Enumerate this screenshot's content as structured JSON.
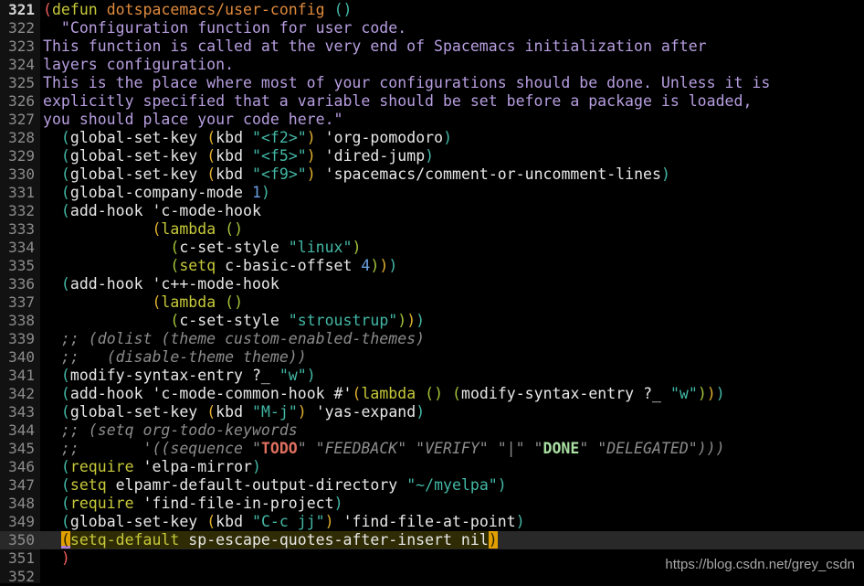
{
  "editor": {
    "current_line": 350,
    "lines": [
      {
        "n": "321",
        "tokens": [
          [
            "p1",
            "("
          ],
          [
            "kw",
            "defun"
          ],
          [
            "sym",
            " "
          ],
          [
            "fn",
            "dotspacemacs/user-config"
          ],
          [
            "sym",
            " "
          ],
          [
            "p2",
            "()"
          ]
        ]
      },
      {
        "n": "322",
        "tokens": [
          [
            "doc",
            "  \"Configuration function for user code."
          ]
        ]
      },
      {
        "n": "323",
        "tokens": [
          [
            "doc",
            "This function is called at the very end of Spacemacs initialization after"
          ]
        ]
      },
      {
        "n": "324",
        "tokens": [
          [
            "doc",
            "layers configuration."
          ]
        ]
      },
      {
        "n": "325",
        "tokens": [
          [
            "doc",
            "This is the place where most of your configurations should be done. Unless it is"
          ]
        ]
      },
      {
        "n": "326",
        "tokens": [
          [
            "doc",
            "explicitly specified that a variable should be set before a package is loaded,"
          ]
        ]
      },
      {
        "n": "327",
        "tokens": [
          [
            "doc",
            "you should place your code here.\""
          ]
        ]
      },
      {
        "n": "328",
        "tokens": [
          [
            "sym",
            "  "
          ],
          [
            "p2",
            "("
          ],
          [
            "sym",
            "global-set-key "
          ],
          [
            "p3",
            "("
          ],
          [
            "sym",
            "kbd "
          ],
          [
            "str",
            "\"<f2>\""
          ],
          [
            "p3",
            ")"
          ],
          [
            "sym",
            " 'org-pomodoro"
          ],
          [
            "p2",
            ")"
          ]
        ]
      },
      {
        "n": "329",
        "tokens": [
          [
            "sym",
            "  "
          ],
          [
            "p2",
            "("
          ],
          [
            "sym",
            "global-set-key "
          ],
          [
            "p3",
            "("
          ],
          [
            "sym",
            "kbd "
          ],
          [
            "str",
            "\"<f5>\""
          ],
          [
            "p3",
            ")"
          ],
          [
            "sym",
            " 'dired-jump"
          ],
          [
            "p2",
            ")"
          ]
        ]
      },
      {
        "n": "330",
        "tokens": [
          [
            "sym",
            "  "
          ],
          [
            "p2",
            "("
          ],
          [
            "sym",
            "global-set-key "
          ],
          [
            "p3",
            "("
          ],
          [
            "sym",
            "kbd "
          ],
          [
            "str",
            "\"<f9>\""
          ],
          [
            "p3",
            ")"
          ],
          [
            "sym",
            " 'spacemacs/comment-or-uncomment-lines"
          ],
          [
            "p2",
            ")"
          ]
        ]
      },
      {
        "n": "331",
        "tokens": [
          [
            "sym",
            "  "
          ],
          [
            "p2",
            "("
          ],
          [
            "sym",
            "global-company-mode "
          ],
          [
            "num",
            "1"
          ],
          [
            "p2",
            ")"
          ]
        ]
      },
      {
        "n": "332",
        "tokens": [
          [
            "sym",
            "  "
          ],
          [
            "p2",
            "("
          ],
          [
            "sym",
            "add-hook 'c-mode-hook"
          ]
        ]
      },
      {
        "n": "333",
        "tokens": [
          [
            "sym",
            "            "
          ],
          [
            "p3",
            "("
          ],
          [
            "kw",
            "lambda"
          ],
          [
            "sym",
            " "
          ],
          [
            "p4",
            "()"
          ]
        ]
      },
      {
        "n": "334",
        "tokens": [
          [
            "sym",
            "              "
          ],
          [
            "p4",
            "("
          ],
          [
            "sym",
            "c-set-style "
          ],
          [
            "str",
            "\"linux\""
          ],
          [
            "p4",
            ")"
          ]
        ]
      },
      {
        "n": "335",
        "tokens": [
          [
            "sym",
            "              "
          ],
          [
            "p4",
            "("
          ],
          [
            "kw",
            "setq"
          ],
          [
            "sym",
            " c-basic-offset "
          ],
          [
            "num",
            "4"
          ],
          [
            "p4",
            ")"
          ],
          [
            "p3",
            ")"
          ],
          [
            "p2",
            ")"
          ]
        ]
      },
      {
        "n": "336",
        "tokens": [
          [
            "sym",
            "  "
          ],
          [
            "p2",
            "("
          ],
          [
            "sym",
            "add-hook 'c++-mode-hook"
          ]
        ]
      },
      {
        "n": "337",
        "tokens": [
          [
            "sym",
            "            "
          ],
          [
            "p3",
            "("
          ],
          [
            "kw",
            "lambda"
          ],
          [
            "sym",
            " "
          ],
          [
            "p4",
            "()"
          ]
        ]
      },
      {
        "n": "338",
        "tokens": [
          [
            "sym",
            "              "
          ],
          [
            "p4",
            "("
          ],
          [
            "sym",
            "c-set-style "
          ],
          [
            "str",
            "\"stroustrup\""
          ],
          [
            "p4",
            ")"
          ],
          [
            "p3",
            ")"
          ],
          [
            "p2",
            ")"
          ]
        ]
      },
      {
        "n": "339",
        "tokens": [
          [
            "sym",
            "  "
          ],
          [
            "com",
            ";; (dolist (theme custom-enabled-themes)"
          ]
        ]
      },
      {
        "n": "340",
        "tokens": [
          [
            "sym",
            "  "
          ],
          [
            "com",
            ";;   (disable-theme theme))"
          ]
        ]
      },
      {
        "n": "341",
        "tokens": [
          [
            "sym",
            "  "
          ],
          [
            "p2",
            "("
          ],
          [
            "sym",
            "modify-syntax-entry ?_ "
          ],
          [
            "str",
            "\"w\""
          ],
          [
            "p2",
            ")"
          ]
        ]
      },
      {
        "n": "342",
        "tokens": [
          [
            "sym",
            "  "
          ],
          [
            "p2",
            "("
          ],
          [
            "sym",
            "add-hook 'c-mode-common-hook #'"
          ],
          [
            "p3",
            "("
          ],
          [
            "kw",
            "lambda"
          ],
          [
            "sym",
            " "
          ],
          [
            "p4",
            "()"
          ],
          [
            "sym",
            " "
          ],
          [
            "p4",
            "("
          ],
          [
            "sym",
            "modify-syntax-entry ?_ "
          ],
          [
            "str",
            "\"w\""
          ],
          [
            "p4",
            ")"
          ],
          [
            "p3",
            ")"
          ],
          [
            "p2",
            ")"
          ]
        ]
      },
      {
        "n": "343",
        "tokens": [
          [
            "sym",
            "  "
          ],
          [
            "p2",
            "("
          ],
          [
            "sym",
            "global-set-key "
          ],
          [
            "p3",
            "("
          ],
          [
            "sym",
            "kbd "
          ],
          [
            "str",
            "\"M-j\""
          ],
          [
            "p3",
            ")"
          ],
          [
            "sym",
            " 'yas-expand"
          ],
          [
            "p2",
            ")"
          ]
        ]
      },
      {
        "n": "344",
        "tokens": [
          [
            "sym",
            "  "
          ],
          [
            "com",
            ";; (setq org-todo-keywords"
          ]
        ]
      },
      {
        "n": "345",
        "tokens": [
          [
            "sym",
            "  "
          ],
          [
            "com",
            ";;       '((sequence \""
          ],
          [
            "todo",
            "TODO"
          ],
          [
            "com",
            "\" \"FEEDBACK\" \"VERIFY\" \"|\" \""
          ],
          [
            "done",
            "DONE"
          ],
          [
            "com",
            "\" \"DELEGATED\")))"
          ]
        ]
      },
      {
        "n": "346",
        "tokens": [
          [
            "sym",
            "  "
          ],
          [
            "p2",
            "("
          ],
          [
            "kw",
            "require"
          ],
          [
            "sym",
            " 'elpa-mirror"
          ],
          [
            "p2",
            ")"
          ]
        ]
      },
      {
        "n": "347",
        "tokens": [
          [
            "sym",
            "  "
          ],
          [
            "p2",
            "("
          ],
          [
            "kw",
            "setq"
          ],
          [
            "sym",
            " elpamr-default-output-directory "
          ],
          [
            "str",
            "\"~/myelpa\""
          ],
          [
            "p2",
            ")"
          ]
        ]
      },
      {
        "n": "348",
        "tokens": [
          [
            "sym",
            "  "
          ],
          [
            "p2",
            "("
          ],
          [
            "kw",
            "require"
          ],
          [
            "sym",
            " 'find-file-in-project"
          ],
          [
            "p2",
            ")"
          ]
        ]
      },
      {
        "n": "349",
        "tokens": [
          [
            "sym",
            "  "
          ],
          [
            "p2",
            "("
          ],
          [
            "sym",
            "global-set-key "
          ],
          [
            "p3",
            "("
          ],
          [
            "sym",
            "kbd "
          ],
          [
            "str",
            "\"C-c jj\""
          ],
          [
            "p3",
            ")"
          ],
          [
            "sym",
            " 'find-file-at-point"
          ],
          [
            "p2",
            ")"
          ]
        ]
      },
      {
        "n": "350",
        "tokens": [
          [
            "sym",
            "  "
          ],
          [
            "match-open",
            "("
          ],
          [
            "kw hl",
            "setq-default"
          ],
          [
            "sym hl",
            " sp-escape-quotes-after-insert nil"
          ],
          [
            "match",
            ")"
          ]
        ]
      },
      {
        "n": "351",
        "tokens": [
          [
            "sym",
            "  "
          ],
          [
            "p1",
            ")"
          ]
        ]
      },
      {
        "n": "352",
        "tokens": []
      }
    ]
  },
  "watermark": "https://blog.csdn.net/grey_csdn"
}
